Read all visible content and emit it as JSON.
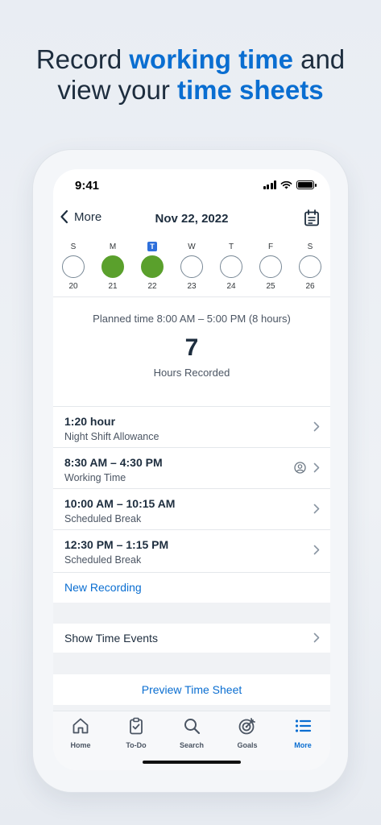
{
  "headline": {
    "line1_plain": "Record ",
    "line1_highlight": "working time",
    "line1_tail": " and",
    "line2_plain": "view your ",
    "line2_highlight": "time sheets"
  },
  "status": {
    "time": "9:41"
  },
  "nav": {
    "back_label": "More",
    "title": "Nov 22, 2022"
  },
  "week": [
    {
      "name": "S",
      "num": "20",
      "recorded": false,
      "today": false
    },
    {
      "name": "M",
      "num": "21",
      "recorded": true,
      "today": false
    },
    {
      "name": "T",
      "num": "22",
      "recorded": true,
      "today": true
    },
    {
      "name": "W",
      "num": "23",
      "recorded": false,
      "today": false
    },
    {
      "name": "T",
      "num": "24",
      "recorded": false,
      "today": false
    },
    {
      "name": "F",
      "num": "25",
      "recorded": false,
      "today": false
    },
    {
      "name": "S",
      "num": "26",
      "recorded": false,
      "today": false
    }
  ],
  "summary": {
    "planned": "Planned time 8:00 AM – 5:00 PM (8 hours)",
    "hours_value": "7",
    "hours_label": "Hours Recorded"
  },
  "entries": [
    {
      "title": "1:20 hour",
      "subtitle": "Night Shift Allowance",
      "has_user_icon": false
    },
    {
      "title": "8:30 AM – 4:30 PM",
      "subtitle": "Working Time",
      "has_user_icon": true
    },
    {
      "title": "10:00 AM – 10:15 AM",
      "subtitle": "Scheduled Break",
      "has_user_icon": false
    },
    {
      "title": "12:30 PM – 1:15 PM",
      "subtitle": "Scheduled Break",
      "has_user_icon": false
    }
  ],
  "new_recording": "New Recording",
  "show_time_events": "Show Time Events",
  "preview_time_sheet": "Preview Time Sheet",
  "tabs": [
    {
      "label": "Home",
      "icon": "home-icon",
      "active": false
    },
    {
      "label": "To-Do",
      "icon": "clipboard-check-icon",
      "active": false
    },
    {
      "label": "Search",
      "icon": "search-icon",
      "active": false
    },
    {
      "label": "Goals",
      "icon": "target-icon",
      "active": false
    },
    {
      "label": "More",
      "icon": "list-icon",
      "active": true
    }
  ],
  "colors": {
    "accent": "#0a6ed1",
    "recorded_day": "#5aa02c",
    "today_badge": "#2e6fdb",
    "text": "#1d2d3e"
  }
}
